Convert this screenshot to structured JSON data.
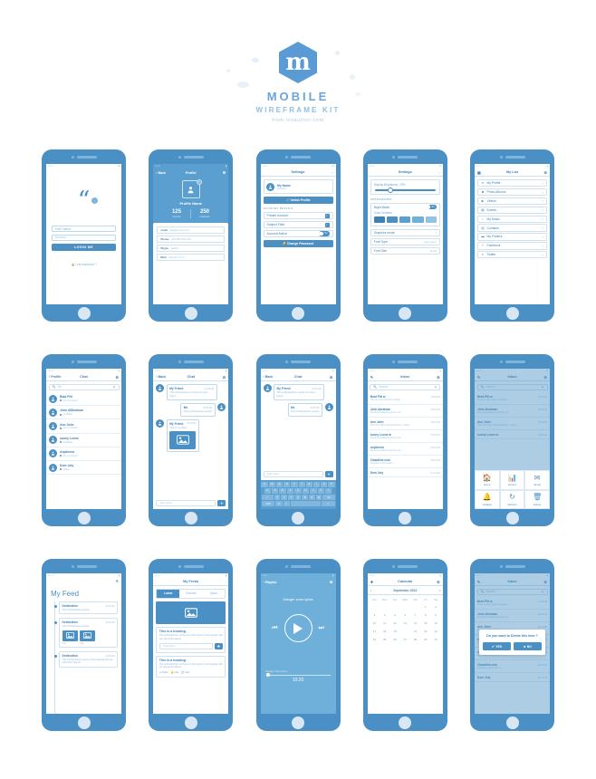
{
  "brand": {
    "mark": "m",
    "title": "MOBILE",
    "subtitle": "WIREFRAME KIT",
    "from": "from iosauthor.com",
    "accent": "#4a90c4",
    "accent_light": "#5b9fd0",
    "page_bg": "#ffffff"
  },
  "status_bar": {
    "carrier": "•••••",
    "battery": "▮"
  },
  "screens": {
    "login": {
      "quote_glyph": "“",
      "username_value": "User Name",
      "password_value": "••••••••••",
      "login_label": "LOGIN ME",
      "lost_password": "Lost password ?"
    },
    "profile": {
      "back": "Back",
      "title": "Profile",
      "gear": "⚙",
      "badge": "0",
      "name": "Profile Name",
      "stats": [
        {
          "value": "125",
          "label": "Friends"
        },
        {
          "value": "250",
          "label": "Followers"
        }
      ],
      "details": [
        {
          "key": "email",
          "value": "mail@email.com"
        },
        {
          "key": "Phone",
          "value": "+99 999 555 222"
        },
        {
          "key": "Skype",
          "value": "me007"
        },
        {
          "key": "Web",
          "value": "ciauthor.com/"
        }
      ]
    },
    "settings_account": {
      "title": "Settings",
      "name": "My Name",
      "handle": "@me007",
      "unlink_label": "Unlink Profile",
      "section_label": "ACCOUNT DETAILS",
      "rows": [
        {
          "label": "Private Account",
          "control": "checkbox",
          "value": "✓"
        },
        {
          "label": "Subject Field",
          "control": "checkbox",
          "value": "✓"
        },
        {
          "label": "Account Active",
          "control": "toggle",
          "value": "No"
        }
      ],
      "change_password_label": "Change Password"
    },
    "settings_display": {
      "title": "Settings",
      "brightness_label": "Display Brightness -70%",
      "brightness_value": 70,
      "section_label": "APPEARANCE",
      "night_mode_label": "Night Mode",
      "night_mode_value": "No",
      "color_scheme_label": "Color Scheme",
      "swatches": [
        "#3f81b5",
        "#4a90c4",
        "#5b9fd0",
        "#6fb0da",
        "#8fc4e6"
      ],
      "rows": [
        {
          "label": "Graphics mode",
          "value": "›"
        },
        {
          "label": "Font Type",
          "value": "Open Sans"
        },
        {
          "label": "Font Size",
          "value": "Small"
        }
      ]
    },
    "my_list": {
      "title": "My List",
      "grid_icon": "▦",
      "gear": "⚙",
      "items": [
        {
          "label": "My Profile",
          "icon": "user-icon",
          "glyph": "●"
        },
        {
          "label": "Photo Albums",
          "icon": "camera-icon",
          "glyph": "■"
        },
        {
          "label": "Videos",
          "icon": "video-icon",
          "glyph": "▶"
        },
        {
          "label": "Events",
          "icon": "calendar-icon",
          "glyph": "▤"
        },
        {
          "label": "My Music",
          "icon": "music-icon",
          "glyph": "♪"
        },
        {
          "label": "Contacts",
          "icon": "contacts-icon",
          "glyph": "▥"
        },
        {
          "label": "My Folders",
          "icon": "folder-icon",
          "glyph": "▬"
        },
        {
          "label": "Facebook",
          "icon": "facebook-icon",
          "glyph": "f"
        },
        {
          "label": "Twitter",
          "icon": "twitter-icon",
          "glyph": "✓"
        }
      ]
    },
    "chat_list": {
      "back": "Profile",
      "title": "Chat",
      "gear": "⚙",
      "search_placeholder": "Search",
      "search_value": "Se",
      "contacts": [
        {
          "name": "Blad Pitt",
          "status": "Do not disturb"
        },
        {
          "name": "John ABbraham",
          "status": "Available"
        },
        {
          "name": "Ann John",
          "status": "Do not disturb"
        },
        {
          "name": "sunny Leone",
          "status": "Available"
        },
        {
          "name": "Anjaleena",
          "status": "Do not disturb"
        },
        {
          "name": "Dom Joly",
          "status": "Offline"
        }
      ]
    },
    "chat": {
      "back": "Back",
      "title": "Chat",
      "gear": "⚙",
      "messages": [
        {
          "who": "My Friend",
          "time": "10:30 AM",
          "text": "This is Photoshop's version of Lorem Ipsum.",
          "side": "them"
        },
        {
          "who": "Me",
          "time": "10:32 AM",
          "text": "This is Photoshop's version",
          "side": "me"
        },
        {
          "who": "My Friend",
          "time": "10:35 AM",
          "text": "This is my photo",
          "side": "them",
          "photo": true
        }
      ],
      "composer_placeholder": "Type here..",
      "send_glyph": "✦"
    },
    "chat_keyboard": {
      "back": "Back",
      "title": "Chat",
      "gear": "⚙",
      "messages": [
        {
          "who": "My Friend",
          "time": "10:30 AM",
          "text": "This is Photoshop's version of Lorem Ipsum.",
          "side": "them"
        },
        {
          "who": "Me",
          "time": "10:32 AM",
          "text": "This is Photoshop's version",
          "side": "me"
        }
      ],
      "composer_placeholder": "Type here..",
      "send_glyph": "✦",
      "keyboard": {
        "row1": [
          "Q",
          "W",
          "E",
          "R",
          "T",
          "Y",
          "U",
          "I",
          "O",
          "P"
        ],
        "row2": [
          "A",
          "S",
          "D",
          "F",
          "G",
          "H",
          "J",
          "K",
          "L"
        ],
        "row3": [
          "⇧",
          "Z",
          "X",
          "C",
          "V",
          "B",
          "N",
          "M",
          "⌫"
        ],
        "row4": [
          "?123",
          "⚙",
          "☺",
          "space",
          "↵"
        ]
      }
    },
    "inbox": {
      "title": "Inbox",
      "compose_icon": "compose-icon",
      "gear": "⚙",
      "search_placeholder": "Search",
      "mails": [
        {
          "from": "Brad Pitt ✉",
          "date": "10:30 AM",
          "subject": "This is a test email for nothing"
        },
        {
          "from": "John Abraham",
          "date": "06.25 AM",
          "subject": "Recommendations just for you"
        },
        {
          "from": "Ann John",
          "date": "08.13 AM",
          "subject": "Pick Your New Year Resolution - Offers"
        },
        {
          "from": "sunny Leone ✉",
          "date": "08.05 AM",
          "subject": "Recommendations just for you"
        },
        {
          "from": "Anjaleena",
          "date": "06.24 AM",
          "subject": "Recommendations just for you"
        },
        {
          "from": "Ciaauthor.com",
          "date": "08.13 AM",
          "subject": "Freebies of this week :)"
        },
        {
          "from": "Dom Joly",
          "date": "07.15 AM",
          "subject": ""
        }
      ]
    },
    "action_sheet": {
      "title": "Inbox",
      "search_placeholder": "Search",
      "actions": [
        {
          "label": "Home",
          "icon": "home-icon"
        },
        {
          "label": "Report",
          "icon": "chart-icon"
        },
        {
          "label": "Email",
          "icon": "envelope-icon"
        },
        {
          "label": "Updates",
          "icon": "bell-icon"
        },
        {
          "label": "Refresh",
          "icon": "refresh-icon"
        },
        {
          "label": "Delete",
          "icon": "trash-icon"
        }
      ]
    },
    "feed": {
      "title": "My Feed",
      "gear": "⚙",
      "cards": [
        {
          "who": "Destination",
          "time": "10:30 AM",
          "text": "This is Photoshop's version",
          "photos": []
        },
        {
          "who": "Destination",
          "time": "10:30 AM",
          "text": "This is Photoshop's version",
          "photos": [
            {
              "cap": "Like"
            },
            {
              "cap": "Like"
            }
          ]
        },
        {
          "who": "Destination",
          "time": "10:30 AM",
          "text": "This is Photoshop's version. Proin gravida nibh vel velit auctor aliquet.",
          "photos": []
        }
      ]
    },
    "feeds_tabs": {
      "title": "My Feeds",
      "tabs": [
        {
          "label": "Latest",
          "active": true
        },
        {
          "label": "Favorite",
          "active": false
        },
        {
          "label": "Spam",
          "active": false
        }
      ],
      "posts": [
        {
          "heading": "This is a heading",
          "body": "This is Photoshop's version of Lorem Ipsum. Proin gravida nibh vel velit auctor aliquet.",
          "composer": "Type here..",
          "send_glyph": "✚"
        },
        {
          "heading": "This is a heading",
          "body": "This is Photoshop's version of Lorem Ipsum. Proin gravida nibh vel velit auctor aliquet.",
          "actions": [
            "Share",
            "Like",
            "Like"
          ]
        }
      ]
    },
    "player": {
      "back": "Playlist",
      "gear": "⚙",
      "track_title": "Danger zone lyrics",
      "seek_label": "Danger zone lyrics...",
      "time": "10:20",
      "play_glyph": "▶",
      "prev_glyph": "⏮",
      "next_glyph": "⏭"
    },
    "calendar": {
      "title": "Calendar",
      "add_glyph": "✚",
      "gear": "⚙",
      "month": "September 2013",
      "prev": "‹",
      "next": "›",
      "day_headers": [
        "Sun",
        "Mon",
        "Tue",
        "Wed",
        "Thu",
        "Fri",
        "Sat"
      ],
      "leading_blanks": 5,
      "days": [
        1,
        2,
        3,
        4,
        5,
        6,
        7,
        8,
        9,
        10,
        11,
        12,
        13,
        14,
        15,
        16,
        17,
        18,
        19,
        20,
        21,
        22,
        23,
        24,
        25,
        26,
        27,
        28,
        29,
        30
      ],
      "selected_day": 20
    },
    "confirm_dialog": {
      "title": "Inbox",
      "search_placeholder": "Search",
      "message": "Do you want to Delete this item ?",
      "yes_label": "YES",
      "no_label": "NO",
      "yes_glyph": "✔",
      "no_glyph": "■",
      "mails": [
        {
          "from": "Brad Pitt ✉",
          "date": "10:30 AM",
          "subject": "This is a test email for nothing"
        },
        {
          "from": "John Abraham",
          "date": "06.25 AM",
          "subject": "Recommendations just for you"
        },
        {
          "from": "Ann John",
          "date": "08.13 AM",
          "subject": "Pick Your New Year Resolution"
        },
        {
          "from": "sunny Leone ✉",
          "date": "08.05 AM",
          "subject": "Recommendations just for you"
        },
        {
          "from": "Anjaleena",
          "date": "06.24 AM",
          "subject": "Recommendations just for you"
        },
        {
          "from": "Ciaauthor.com",
          "date": "08.13 AM",
          "subject": "Freebies of this week :)"
        },
        {
          "from": "Dom Joly",
          "date": "07.15 AM",
          "subject": ""
        }
      ]
    }
  }
}
